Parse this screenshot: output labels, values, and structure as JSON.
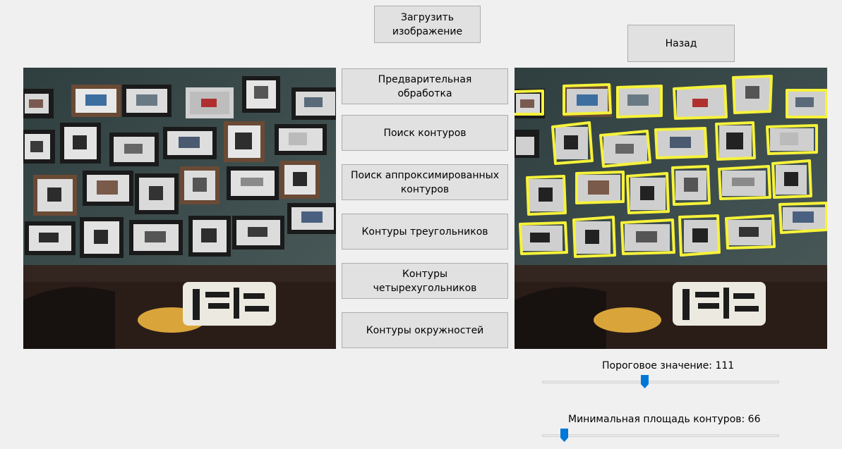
{
  "buttons": {
    "load_image": "Загрузить\nизображение",
    "back": "Назад",
    "preprocess": "Предварительная\nобработка",
    "find_contours": "Поиск контуров",
    "find_approx_contours": "Поиск аппроксимированных\nконтуров",
    "triangle_contours": "Контуры треугольников",
    "quad_contours": "Контуры\nчетырехугольников",
    "circle_contours": "Контуры окружностей"
  },
  "images": {
    "original": {
      "icon": "photo-wall-sofa-image"
    },
    "processed": {
      "icon": "photo-wall-sofa-detected-contours-image",
      "highlight_color": "#f6f23a"
    }
  },
  "threshold": {
    "label": "Пороговое значение: 111",
    "value": 111,
    "fraction": 0.43
  },
  "min_area": {
    "label": "Минимальная площадь контуров: 66",
    "value": 66,
    "fraction": 0.08
  },
  "colors": {
    "background": "#f0f0f0",
    "button_face": "#e1e1e1",
    "button_border": "#adadad",
    "slider_thumb": "#0078d7"
  }
}
